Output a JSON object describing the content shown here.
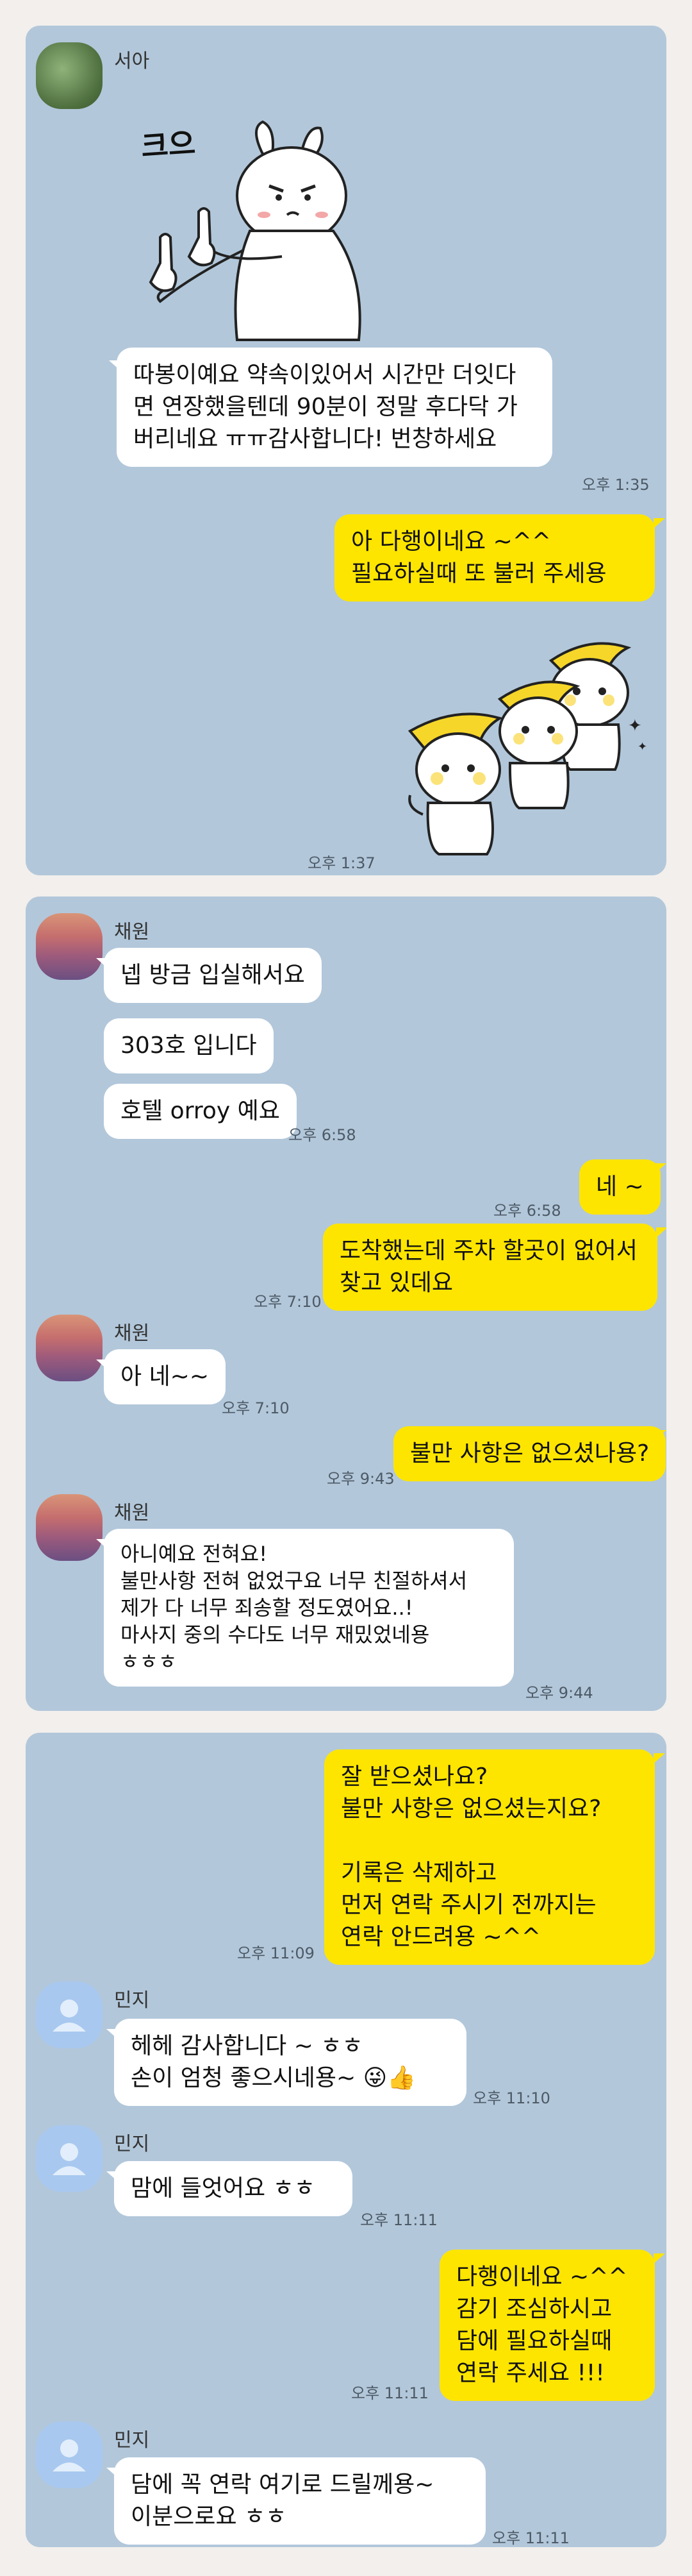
{
  "panel1": {
    "sender": "서아",
    "sticker_caption": "크으",
    "msg_thanks": "따봉이예요 약속이있어서 시간만 더잇다면 연장했을텐데 90분이 정말 후다닥 가버리네요 ㅠㅠ감사합니다! 번창하세요",
    "time_thanks": "오후 1:35",
    "reply": "아 다행이네요 ~^^\n필요하실때 또 불러 주세용",
    "time_sticker": "오후 1:37"
  },
  "panel2": {
    "sender1": "채원",
    "msg1": "넵 방금 입실해서요",
    "msg2": "303호 입니다",
    "msg3": "호텔 orroy 예요",
    "time1": "오후 6:58",
    "reply1": "네 ~",
    "time2": "오후 6:58",
    "reply2": "도착했는데  주차 할곳이 없어서\n찾고 있데요",
    "time3": "오후 7:10",
    "sender2": "채원",
    "msg4": "아 네~~",
    "time4": "오후 7:10",
    "reply3": "불만 사항은 없으셨나용?",
    "time5": "오후 9:43",
    "sender3": "채원",
    "msg5": "아니예요 전혀요!\n불만사항 전혀 없었구요 너무 친절하셔서\n제가 다 너무 죄송할 정도였어요..!\n마사지 중의 수다도 너무 재밌었네용\nㅎㅎㅎ",
    "time6": "오후 9:44"
  },
  "panel3": {
    "reply1": "잘 받으셨나요?\n불만 사항은 없으셨는지요?\n\n기록은 삭제하고\n먼저 연락 주시기 전까지는\n연락 안드려용 ~^^",
    "time1": "오후 11:09",
    "sender1": "민지",
    "msg1": "헤헤 감사합니다 ~ ㅎㅎ\n손이 엄청 좋으시네용~ 😜👍",
    "time2": "오후 11:10",
    "sender2": "민지",
    "msg2": "맘에 들엇어요 ㅎㅎ",
    "time3": "오후 11:11",
    "reply2": "다행이네요 ~^^\n감기 조심하시고\n담에 필요하실때\n연락 주세요 !!!",
    "time4": "오후 11:11",
    "sender3": "민지",
    "msg3": "담에 꼭 연락 여기로 드릴께용~\n이분으로요 ㅎㅎ",
    "time5": "오후 11:11"
  },
  "colors": {
    "chat_bg": "#b2c7da",
    "mine": "#fee500",
    "theirs": "#ffffff",
    "page_bg": "#f2efec"
  }
}
